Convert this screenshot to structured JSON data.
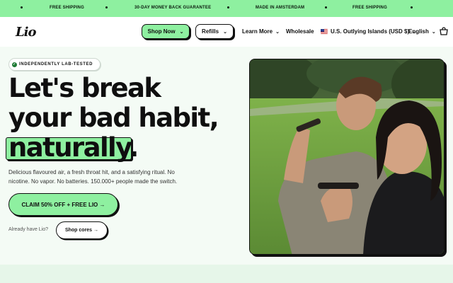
{
  "announcement": {
    "messages": [
      "FREE SHIPPING",
      "30-DAY MONEY BACK GUARANTEE",
      "MADE IN AMSTERDAM",
      "FREE SHIPPING"
    ]
  },
  "header": {
    "logo": "Lio",
    "nav": {
      "shop_now": "Shop Now",
      "refills": "Refills",
      "learn_more": "Learn More",
      "wholesale": "Wholesale",
      "region": "U.S. Outlying Islands (USD $)",
      "language": "English"
    },
    "icons": {
      "chevron": "chevron-down-icon",
      "cart": "cart-icon",
      "flag": "us-flag-icon"
    }
  },
  "hero": {
    "badge": "INDEPENDENTLY LAB-TESTED",
    "headline_line1": "Let's break",
    "headline_line2": "your bad habit,",
    "headline_highlight": "naturally.",
    "subcopy": "Delicious flavoured air, a fresh throat hit, and a satisfying ritual. No nicotine. No vapor. No batteries. 150.000+ people made the switch.",
    "cta": "CLAIM 50% OFF + FREE LIO →",
    "already_label": "Already have Lio?",
    "shop_cores": "Shop cores →"
  },
  "colors": {
    "accent": "#8ef0a0",
    "dark": "#111111",
    "background": "#f4fbf5"
  }
}
